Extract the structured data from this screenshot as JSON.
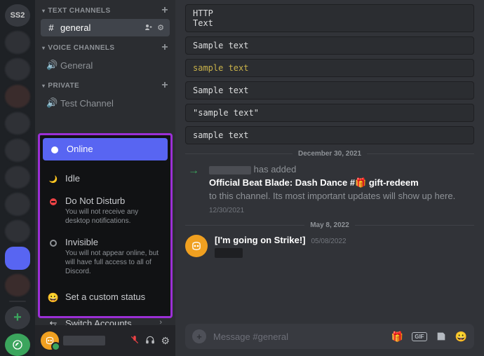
{
  "rail": {
    "top_server_label": "SS2"
  },
  "sections": {
    "text_channels": "TEXT CHANNELS",
    "voice_channels": "VOICE CHANNELS",
    "private": "PRIVATE"
  },
  "channels": {
    "general": "general",
    "voice_general": "General",
    "private_test": "Test Channel"
  },
  "status_menu": {
    "online": "Online",
    "idle": "Idle",
    "dnd": "Do Not Disturb",
    "dnd_desc": "You will not receive any desktop notifications.",
    "invisible": "Invisible",
    "invisible_desc": "You will not appear online, but will have full access to all of Discord.",
    "custom": "Set a custom status",
    "switch": "Switch Accounts"
  },
  "chat": {
    "code_blocks": [
      " HTTP\nText",
      "Sample text",
      "sample text",
      "Sample text",
      "\"sample text\"",
      "sample text"
    ],
    "divider1": "December 30, 2021",
    "sys_added": "has added",
    "sys_title": "Official Beat Blade: Dash Dance #🎁 gift-redeem",
    "sys_tail": " to this channel. Its most important updates will show up here.",
    "sys_ts": "12/30/2021",
    "divider2": "May 8, 2022",
    "msg_text": "[I'm going on Strike!]",
    "msg_ts": "05/08/2022"
  },
  "input": {
    "placeholder": "Message #general",
    "gif_label": "GIF"
  }
}
